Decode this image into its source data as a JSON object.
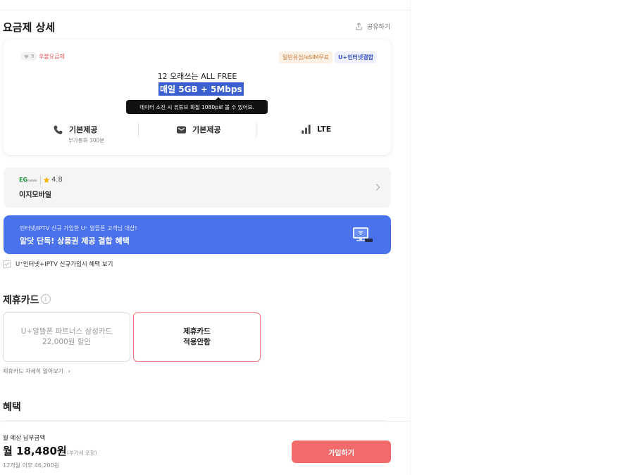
{
  "header": {
    "title": "요금제 상세",
    "share_label": "공유하기"
  },
  "plan": {
    "likes": "9",
    "tag": "후불요금제",
    "chips": [
      "일반유심/eSIM무료",
      "U+인터넷결합"
    ],
    "name": "12 오래쓰는 ALL FREE",
    "data": "매일 5GB + 5Mbps",
    "tooltip": "데이터 소진 시 유튜브 화질 1080p로 볼 수 있어요.",
    "features": {
      "call": "기본제공",
      "call_sub": "부가통화 300분",
      "sms": "기본제공",
      "network": "LTE"
    }
  },
  "carrier": {
    "logo_text": "EG",
    "logo_sub": "mobile",
    "rating": "4.8",
    "name": "이지모바일"
  },
  "banner": {
    "subtitle": "인터넷/IPTV 신규 가입한 U⁺ 알뜰폰 고객님 대상!",
    "title": "알닷 단독! 상품권 제공 결합 혜택"
  },
  "bundle_check": {
    "label": "U⁺인터넷+IPTV 신규가입시 혜택 보기"
  },
  "partner_card": {
    "title": "제휴카드",
    "info_symbol": "i",
    "option_a_line1": "U+알뜰폰 파트너스 삼성카드",
    "option_a_line2": "22,000원 할인",
    "option_b_line1": "제휴카드",
    "option_b_line2": "적용안함",
    "more_label": "제휴카드 자세히 알아보기",
    "more_chevron": "›"
  },
  "benefits": {
    "title": "혜택"
  },
  "footer": {
    "label": "월 예상 납부금액",
    "amount": "월 18,480원",
    "vat": "(부가세 포함)",
    "after": "12개월 이후 46,200원",
    "join_label": "가입하기"
  },
  "colors": {
    "accent_blue": "#4a72ec",
    "accent_red": "#f26a6a",
    "highlight": "#3c5fcf"
  }
}
